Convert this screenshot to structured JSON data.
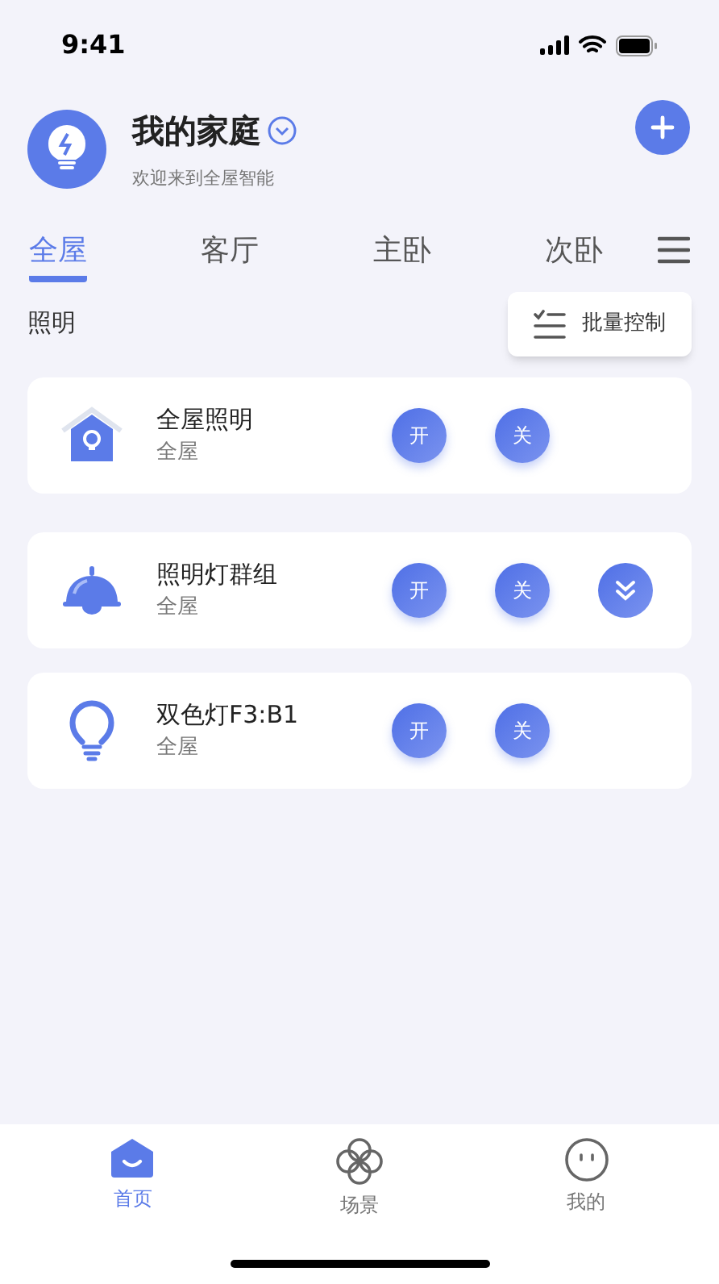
{
  "status_bar": {
    "time": "9:41"
  },
  "header": {
    "title": "我的家庭",
    "subtitle": "欢迎来到全屋智能"
  },
  "tabs": [
    {
      "label": "全屋",
      "selected": true
    },
    {
      "label": "客厅",
      "selected": false
    },
    {
      "label": "主卧",
      "selected": false
    },
    {
      "label": "次卧",
      "selected": false
    }
  ],
  "section": {
    "title": "照明",
    "batch_button": "批量控制"
  },
  "devices": [
    {
      "kind": "house",
      "name": "全屋照明",
      "room": "全屋",
      "actions": [
        {
          "kind": "text",
          "label": "开"
        },
        {
          "kind": "text",
          "label": "关"
        }
      ]
    },
    {
      "kind": "pendant",
      "name": "照明灯群组",
      "room": "全屋",
      "actions": [
        {
          "kind": "text",
          "label": "开"
        },
        {
          "kind": "text",
          "label": "关"
        },
        {
          "kind": "expand"
        }
      ]
    },
    {
      "kind": "bulb",
      "name": "双色灯F3:B1",
      "room": "全屋",
      "actions": [
        {
          "kind": "text",
          "label": "开"
        },
        {
          "kind": "text",
          "label": "关"
        }
      ]
    }
  ],
  "bottom_nav": [
    {
      "kind": "home",
      "label": "首页",
      "selected": true
    },
    {
      "kind": "scene",
      "label": "场景",
      "selected": false
    },
    {
      "kind": "me",
      "label": "我的",
      "selected": false
    }
  ]
}
